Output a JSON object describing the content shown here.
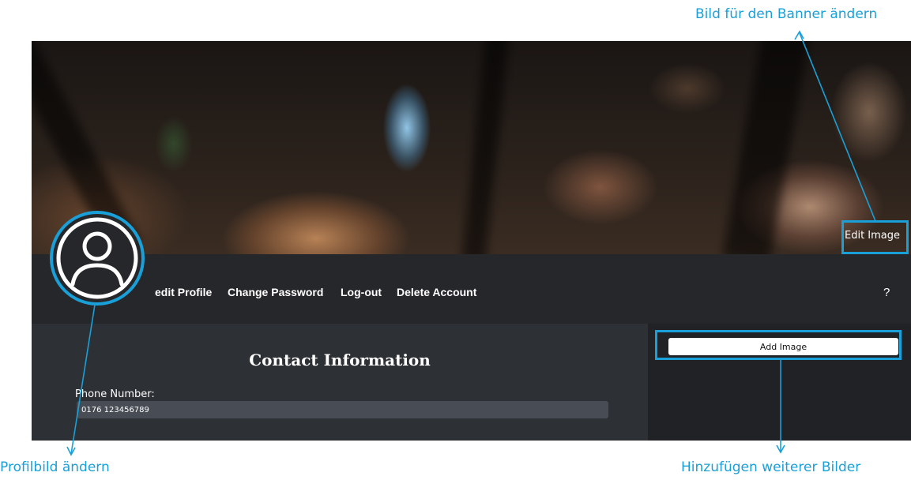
{
  "annotations": {
    "banner": "Bild für den Banner ändern",
    "profile": "Profilbild ändern",
    "gallery": "Hinzufügen weiterer Bilder"
  },
  "banner": {
    "edit_label": "Edit Image"
  },
  "nav": {
    "items": [
      {
        "label": "edit Profile"
      },
      {
        "label": "Change Password"
      },
      {
        "label": "Log-out"
      },
      {
        "label": "Delete Account"
      }
    ],
    "help_label": "?"
  },
  "contact": {
    "title": "Contact Information",
    "phone_label": "Phone Number:",
    "phone_value": "0176 123456789"
  },
  "side": {
    "add_image_label": "Add Image"
  },
  "colors": {
    "accent": "#1aa0d8",
    "navbar": "#25272b",
    "contact_panel": "#2d3035",
    "side_panel": "#202226"
  },
  "icons": {
    "avatar": "user-avatar-icon"
  }
}
